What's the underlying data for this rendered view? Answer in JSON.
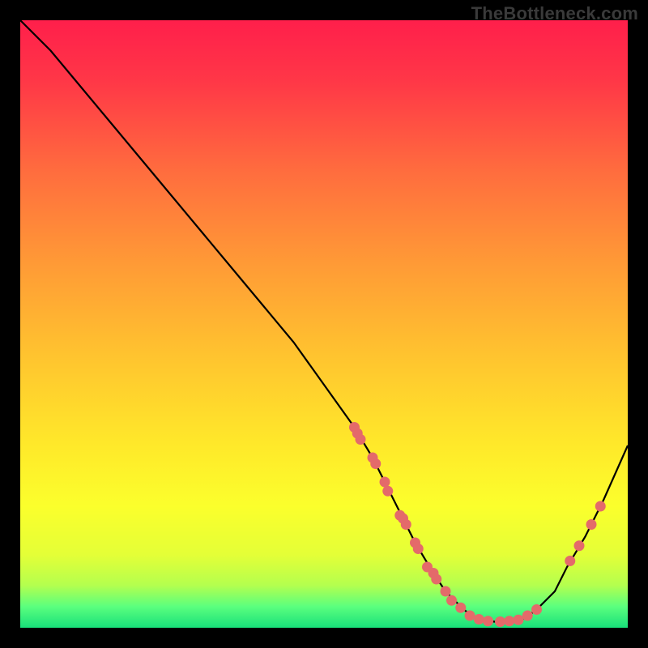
{
  "watermark": "TheBottleneck.com",
  "chart_data": {
    "type": "line",
    "title": "",
    "xlabel": "",
    "ylabel": "",
    "xlim": [
      0,
      100
    ],
    "ylim": [
      0,
      100
    ],
    "curve": {
      "x": [
        0,
        5,
        10,
        15,
        20,
        25,
        30,
        35,
        40,
        45,
        50,
        55,
        58,
        60,
        63,
        65,
        68,
        70,
        73,
        75,
        78,
        80,
        83,
        85,
        88,
        90,
        93,
        96,
        100
      ],
      "y": [
        100,
        95,
        89,
        83,
        77,
        71,
        65,
        59,
        53,
        47,
        40,
        33,
        28,
        24,
        18,
        14,
        9,
        6,
        3,
        1.5,
        1,
        1,
        1.5,
        3,
        6,
        10,
        15,
        21,
        30
      ]
    },
    "markers": [
      {
        "x": 55.0,
        "y": 33.0
      },
      {
        "x": 55.5,
        "y": 32.0
      },
      {
        "x": 56.0,
        "y": 31.0
      },
      {
        "x": 58.0,
        "y": 28.0
      },
      {
        "x": 58.5,
        "y": 27.0
      },
      {
        "x": 60.0,
        "y": 24.0
      },
      {
        "x": 60.5,
        "y": 22.5
      },
      {
        "x": 62.5,
        "y": 18.5
      },
      {
        "x": 63.0,
        "y": 18.0
      },
      {
        "x": 63.5,
        "y": 17.0
      },
      {
        "x": 65.0,
        "y": 14.0
      },
      {
        "x": 65.5,
        "y": 13.0
      },
      {
        "x": 67.0,
        "y": 10.0
      },
      {
        "x": 68.0,
        "y": 9.0
      },
      {
        "x": 68.5,
        "y": 8.0
      },
      {
        "x": 70.0,
        "y": 6.0
      },
      {
        "x": 71.0,
        "y": 4.5
      },
      {
        "x": 72.5,
        "y": 3.3
      },
      {
        "x": 74.0,
        "y": 2.0
      },
      {
        "x": 75.5,
        "y": 1.4
      },
      {
        "x": 77.0,
        "y": 1.1
      },
      {
        "x": 79.0,
        "y": 1.0
      },
      {
        "x": 80.5,
        "y": 1.1
      },
      {
        "x": 82.0,
        "y": 1.3
      },
      {
        "x": 83.5,
        "y": 2.0
      },
      {
        "x": 85.0,
        "y": 3.0
      },
      {
        "x": 90.5,
        "y": 11.0
      },
      {
        "x": 92.0,
        "y": 13.5
      },
      {
        "x": 94.0,
        "y": 17.0
      },
      {
        "x": 95.5,
        "y": 20.0
      }
    ],
    "gradient_stops": [
      {
        "offset": 0.0,
        "color": "#ff1f4b"
      },
      {
        "offset": 0.1,
        "color": "#ff3747"
      },
      {
        "offset": 0.25,
        "color": "#ff6d3e"
      },
      {
        "offset": 0.4,
        "color": "#ff9a36"
      },
      {
        "offset": 0.55,
        "color": "#ffc32f"
      },
      {
        "offset": 0.7,
        "color": "#ffe92a"
      },
      {
        "offset": 0.8,
        "color": "#fbff2c"
      },
      {
        "offset": 0.88,
        "color": "#e4ff37"
      },
      {
        "offset": 0.93,
        "color": "#b4ff4e"
      },
      {
        "offset": 0.965,
        "color": "#5bff7e"
      },
      {
        "offset": 1.0,
        "color": "#18e07a"
      }
    ],
    "marker_color": "#e46a6a",
    "curve_color": "#000000"
  }
}
